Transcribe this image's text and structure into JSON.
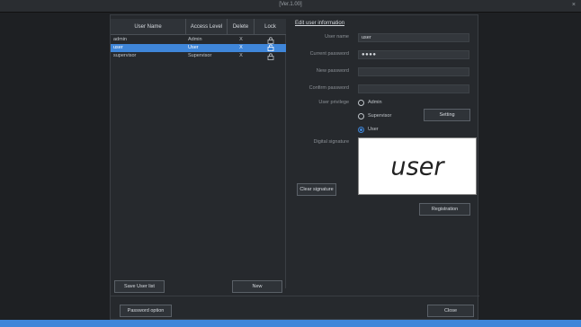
{
  "window": {
    "title": "[Ver.1.00]",
    "close_glyph": "×"
  },
  "table": {
    "headers": {
      "name": "User Name",
      "access": "Access Level",
      "delete": "Delete",
      "lock": "Lock"
    },
    "rows": [
      {
        "name": "admin",
        "access": "Admin",
        "delete": "X",
        "lock_icon": "lock-icon"
      },
      {
        "name": "user",
        "access": "User",
        "delete": "X",
        "lock_icon": "lock-icon",
        "selected": true
      },
      {
        "name": "supervisor",
        "access": "Supervisor",
        "delete": "X",
        "lock_icon": "lock-icon"
      }
    ]
  },
  "edit": {
    "title": "Edit user information",
    "labels": {
      "user_name": "User name",
      "current_password": "Current password",
      "new_password": "New password",
      "confirm_password": "Confirm password",
      "privilege": "User privilege",
      "signature": "Digital signature"
    },
    "values": {
      "user_name": "user",
      "current_password": "●●●●",
      "new_password": "",
      "confirm_password": ""
    },
    "privileges": [
      {
        "label": "Admin",
        "checked": false
      },
      {
        "label": "Supervisor",
        "checked": false
      },
      {
        "label": "User",
        "checked": true
      }
    ],
    "setting_button": "Setting",
    "clear_signature_button": "Clear signature",
    "signature_text": "user",
    "registration_button": "Registration"
  },
  "footer": {
    "save_user_list": "Save User list",
    "new": "New",
    "password_option": "Password option",
    "close": "Close"
  },
  "colors": {
    "accent": "#3f86d9",
    "background": "#1e2023",
    "panel": "#26292d"
  }
}
